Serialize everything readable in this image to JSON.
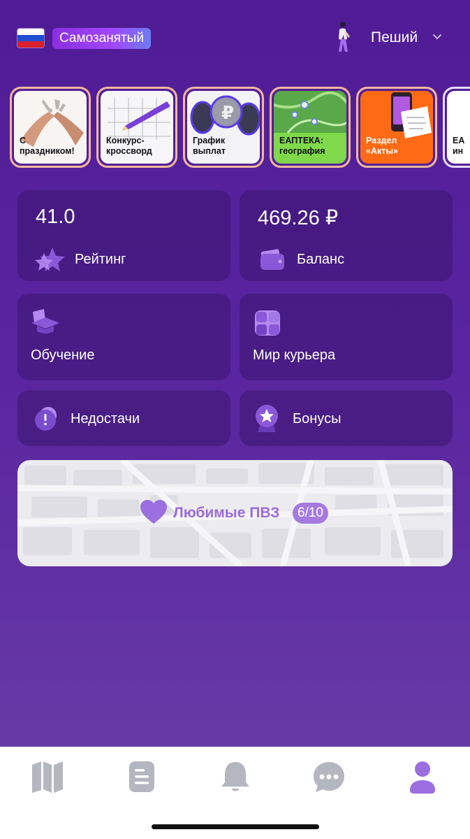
{
  "header": {
    "status_label": "Самозанятый",
    "mode_label": "Пеший",
    "flag_icon": "russia-flag-icon",
    "mode_icon": "walking-person-icon"
  },
  "stories": [
    {
      "caption": "С\nпраздником!",
      "theme": "photo-hands"
    },
    {
      "caption": "Конкурс-\nкроссворд",
      "theme": "crossword"
    },
    {
      "caption": "График\nвыплат",
      "theme": "ruble-coins"
    },
    {
      "caption": "ЕАПТЕКА:\nгеография",
      "theme": "green-map"
    },
    {
      "caption": "Раздел\n«Акты»",
      "theme": "orange-phone"
    },
    {
      "caption": "ЕА\nин",
      "theme": "partial"
    }
  ],
  "cards": {
    "rating": {
      "value": "41.0",
      "label": "Рейтинг",
      "icon": "star-icon"
    },
    "balance": {
      "value": "469.26 ₽",
      "label": "Баланс",
      "icon": "wallet-icon"
    },
    "learning": {
      "label": "Обучение",
      "icon": "graduation-cap-icon"
    },
    "courier_world": {
      "label": "Мир курьера",
      "icon": "apps-grid-icon"
    },
    "shortages": {
      "label": "Недостачи",
      "icon": "exclamation-icon"
    },
    "bonuses": {
      "label": "Бонусы",
      "icon": "award-star-icon"
    }
  },
  "favorites": {
    "label": "Любимые ПВЗ",
    "count": "6/10",
    "icon": "heart-icon"
  },
  "tabbar": {
    "tabs": [
      "map-icon",
      "document-icon",
      "bell-icon",
      "chat-icon",
      "profile-icon"
    ],
    "active": "profile-icon",
    "active_color": "#9b6fe0",
    "inactive_color": "#b4b6c0"
  }
}
